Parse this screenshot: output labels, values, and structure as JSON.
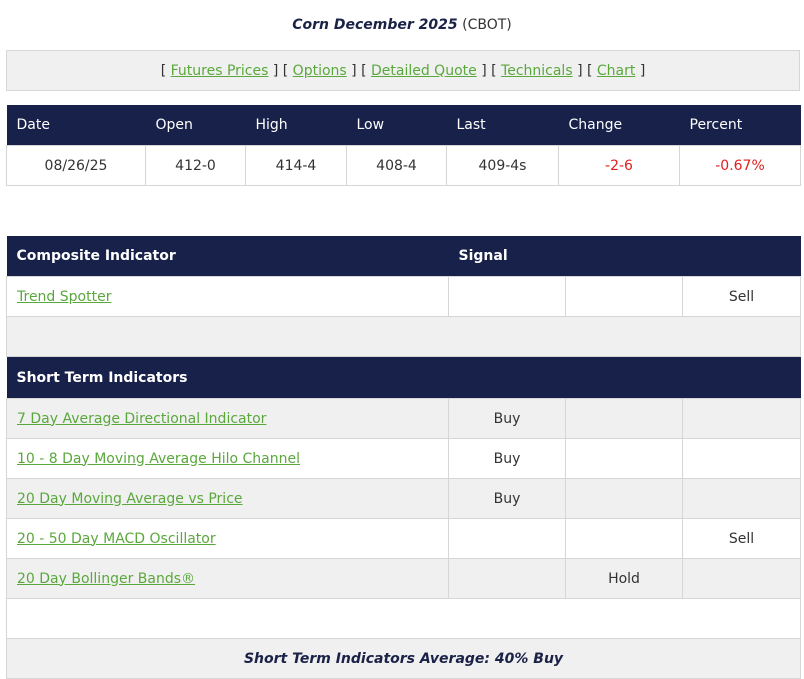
{
  "title": {
    "commodity": "Corn December 2025",
    "exchange": "(CBOT)"
  },
  "nav": {
    "links": [
      "Futures Prices",
      "Options",
      "Detailed Quote",
      "Technicals",
      "Chart"
    ]
  },
  "quote": {
    "headers": [
      "Date",
      "Open",
      "High",
      "Low",
      "Last",
      "Change",
      "Percent"
    ],
    "row": {
      "date": "08/26/25",
      "open": "412-0",
      "high": "414-4",
      "low": "408-4",
      "last": "409-4s",
      "change": "-2-6",
      "percent": "-0.67%"
    }
  },
  "composite": {
    "header": "Composite Indicator",
    "signal_header": "Signal",
    "rows": [
      {
        "name": "Trend Spotter",
        "buy": "",
        "hold": "",
        "sell": "Sell"
      }
    ]
  },
  "short_term": {
    "header": "Short Term Indicators",
    "rows": [
      {
        "name": "7 Day Average Directional Indicator",
        "buy": "Buy",
        "hold": "",
        "sell": ""
      },
      {
        "name": "10 - 8 Day Moving Average Hilo Channel",
        "buy": "Buy",
        "hold": "",
        "sell": ""
      },
      {
        "name": "20 Day Moving Average vs Price",
        "buy": "Buy",
        "hold": "",
        "sell": ""
      },
      {
        "name": "20 - 50 Day MACD Oscillator",
        "buy": "",
        "hold": "",
        "sell": "Sell"
      },
      {
        "name": "20 Day Bollinger Bands®",
        "buy": "",
        "hold": "Hold",
        "sell": ""
      }
    ],
    "average": "Short Term Indicators Average: 40% Buy"
  },
  "colors": {
    "header_bg": "#18214a",
    "link": "#5aa83c",
    "negative": "#e02020",
    "shade": "#f0f0f0"
  }
}
